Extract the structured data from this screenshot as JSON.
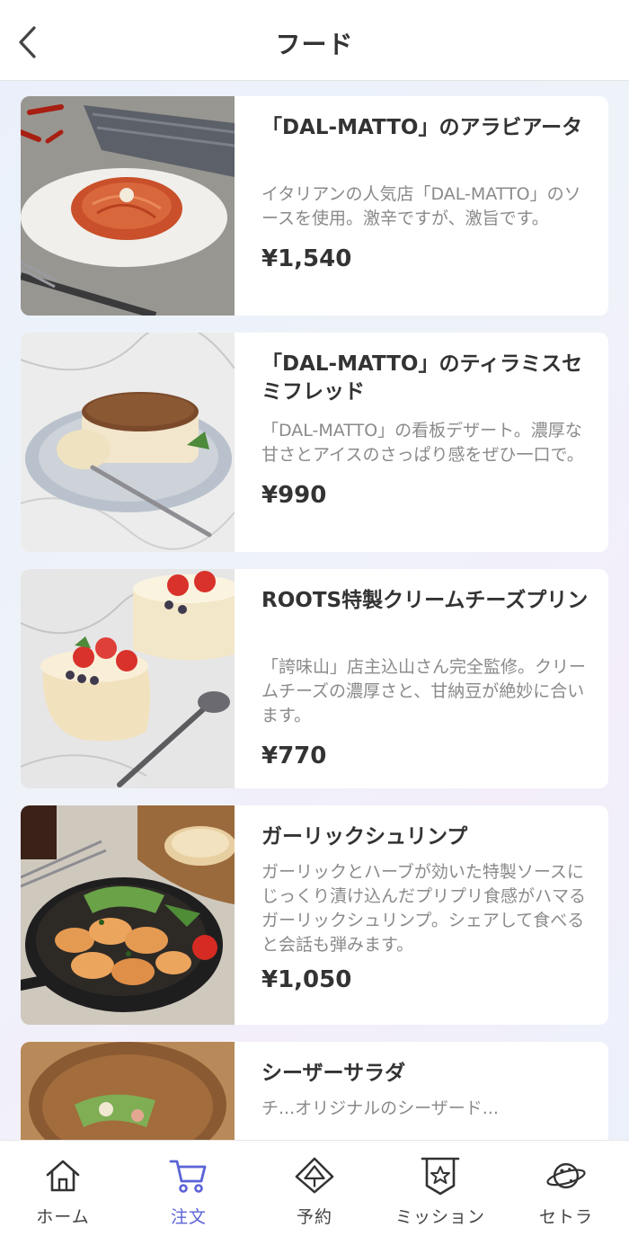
{
  "header": {
    "title": "フード",
    "back_icon": "chevron-left-icon"
  },
  "items": [
    {
      "title": "「DAL-MATTO」のアラビアータ",
      "description": "イタリアンの人気店「DAL-MATTO」のソースを使用。激辛ですが、激旨です。",
      "price": "¥1,540"
    },
    {
      "title": "「DAL-MATTO」のティラミスセミフレッド",
      "description": "「DAL-MATTO」の看板デザート。濃厚な甘さとアイスのさっぱり感をぜひ一口で。",
      "price": "¥990"
    },
    {
      "title": "ROOTS特製クリームチーズプリン",
      "description": "「誇味山」店主込山さん完全監修。クリームチーズの濃厚さと、甘納豆が絶妙に合います。",
      "price": "¥770"
    },
    {
      "title": "ガーリックシュリンプ",
      "description": "ガーリックとハーブが効いた特製ソースにじっくり漬け込んだプリプリ食感がハマるガーリックシュリンプ。シェアして食べると会話も弾みます。",
      "price": "¥1,050"
    },
    {
      "title": "シーザーサラダ",
      "description": "チ...オリジナルのシーザード...",
      "price": ""
    }
  ],
  "nav": {
    "active_color": "#5b63d6",
    "items": [
      {
        "label": "ホーム",
        "icon": "home-icon"
      },
      {
        "label": "注文",
        "icon": "cart-icon"
      },
      {
        "label": "予約",
        "icon": "reservation-icon"
      },
      {
        "label": "ミッション",
        "icon": "mission-badge-icon"
      },
      {
        "label": "セトラ",
        "icon": "planet-icon"
      }
    ]
  }
}
